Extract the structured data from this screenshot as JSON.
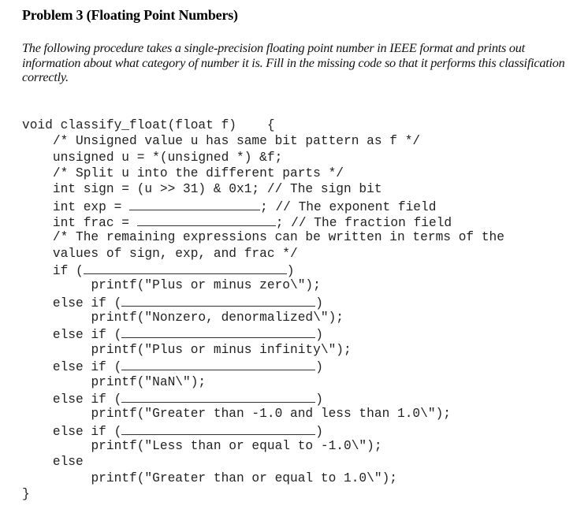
{
  "document": {
    "title": "Problem 3 (Floating Point Numbers)",
    "intro": "The following procedure takes a single-precision floating point number in IEEE format and prints out information about what category of number it is. Fill in the missing code so that it performs this classification correctly.",
    "code": {
      "signature": "void classify_float(float f)    {",
      "comment_unsigned": "/* Unsigned value u has same bit pattern as f */",
      "unsigned_decl": "unsigned u = *(unsigned *) &f;",
      "comment_split": "/* Split u into the different parts */",
      "sign_decl": "int sign = (u >> 31) & 0x1; // The sign bit",
      "exp_prefix": "int exp = ",
      "exp_suffix": "; // The exponent field",
      "frac_prefix": "int frac = ",
      "frac_suffix": "; // The fraction field",
      "comment_remaining_1": "/* The remaining expressions can be written in terms of the",
      "comment_remaining_2": "values of sign, exp, and frac */",
      "if_prefix": "if (",
      "else_if_prefix": "else if (",
      "close_paren": ")",
      "else_kw": "else",
      "closing_brace": "}",
      "branches": [
        "printf(\"Plus or minus zero\\\");",
        "printf(\"Nonzero, denormalized\\\");",
        "printf(\"Plus or minus infinity\\\");",
        "printf(\"NaN\\\");",
        "printf(\"Greater than -1.0 and less than 1.0\\\");",
        "printf(\"Less than or equal to -1.0\\\");",
        "printf(\"Greater than or equal to 1.0\\\");"
      ]
    }
  }
}
